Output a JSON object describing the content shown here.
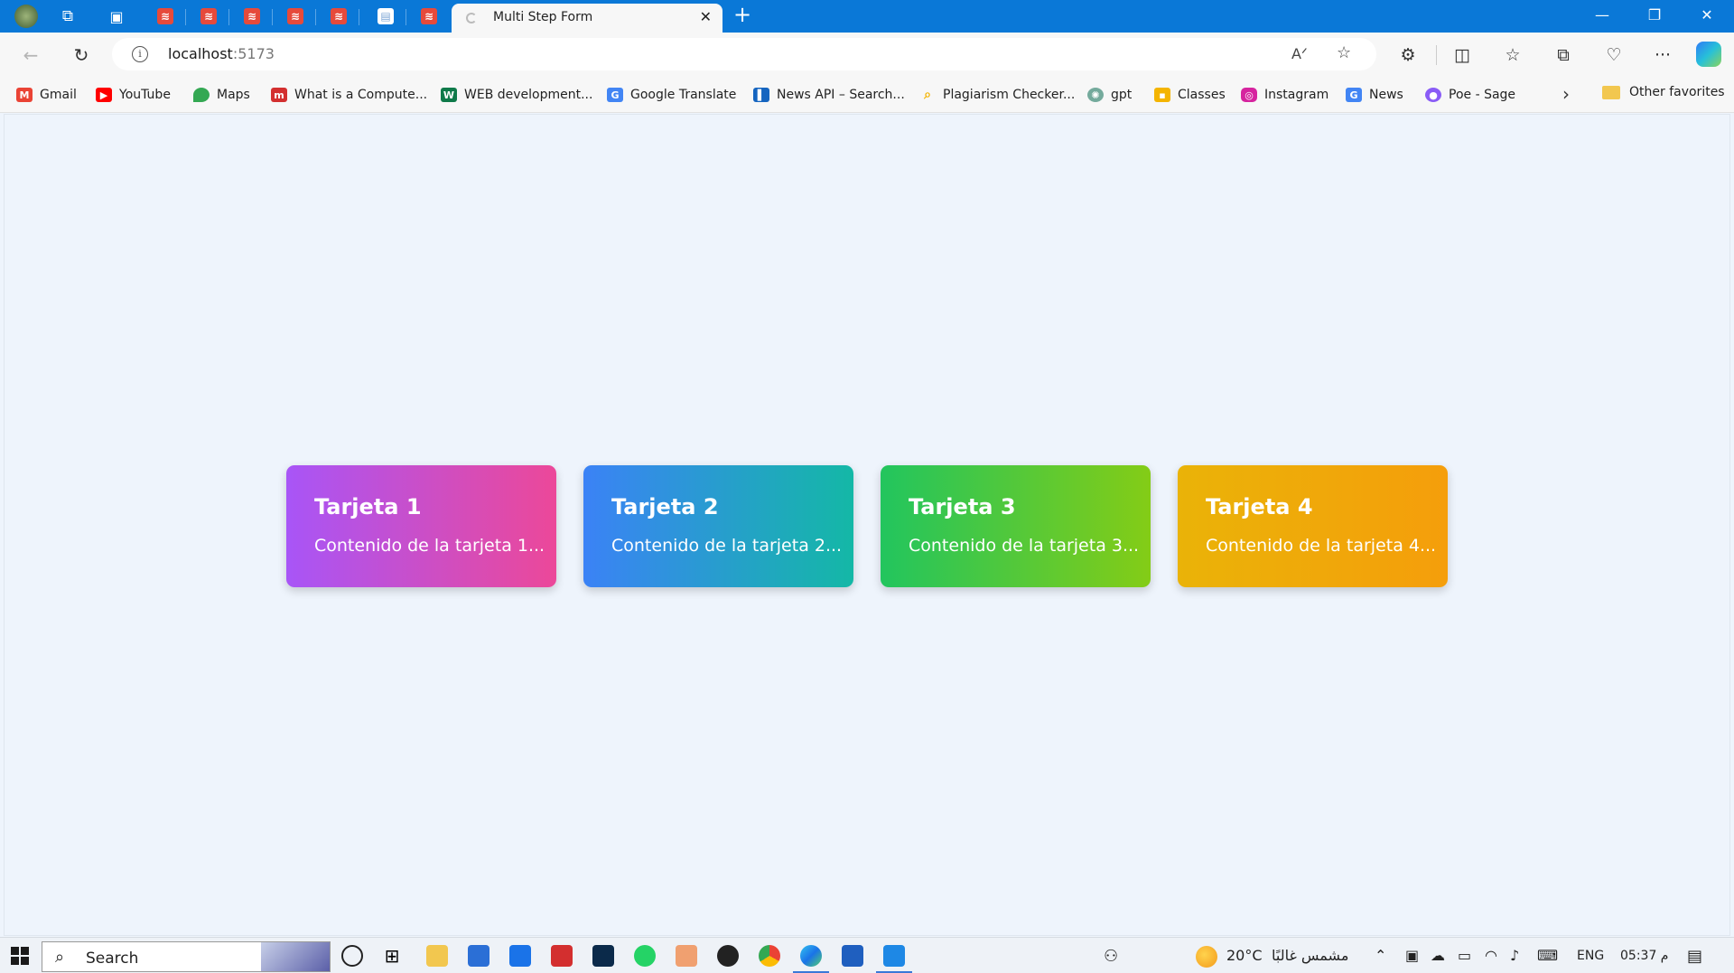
{
  "browser": {
    "active_tab_title": "Multi Step Form",
    "address": {
      "host": "localhost",
      "port": ":5173"
    },
    "favorites": [
      {
        "label": "Gmail",
        "icon": "gmail-icon",
        "color": "#ea4335"
      },
      {
        "label": "YouTube",
        "icon": "youtube-icon",
        "color": "#ff0000"
      },
      {
        "label": "Maps",
        "icon": "maps-icon",
        "color": "#34a853"
      },
      {
        "label": "What is a Compute...",
        "icon": "site-icon",
        "color": "#d32f2f"
      },
      {
        "label": "WEB development...",
        "icon": "site-icon",
        "color": "#0f7a4a"
      },
      {
        "label": "Google Translate",
        "icon": "translate-icon",
        "color": "#4285f4"
      },
      {
        "label": "News API – Search...",
        "icon": "news-api-icon",
        "color": "#1565c0"
      },
      {
        "label": "Plagiarism Checker...",
        "icon": "search-icon",
        "color": "#f4b400"
      },
      {
        "label": "gpt",
        "icon": "chatgpt-icon",
        "color": "#74aa9c"
      },
      {
        "label": "Classes",
        "icon": "classroom-icon",
        "color": "#f4b400"
      },
      {
        "label": "Instagram",
        "icon": "instagram-icon",
        "color": "#d6249f"
      },
      {
        "label": "News",
        "icon": "google-news-icon",
        "color": "#4285f4"
      },
      {
        "label": "Poe - Sage",
        "icon": "poe-icon",
        "color": "#8a5cf6"
      }
    ],
    "other_favorites": "Other favorites"
  },
  "cards": [
    {
      "title": "Tarjeta 1",
      "body": "Contenido de la tarjeta 1...",
      "colors": [
        "#a855f7",
        "#ec4899"
      ]
    },
    {
      "title": "Tarjeta 2",
      "body": "Contenido de la tarjeta 2...",
      "colors": [
        "#3b82f6",
        "#14b8a6"
      ]
    },
    {
      "title": "Tarjeta 3",
      "body": "Contenido de la tarjeta 3...",
      "colors": [
        "#22c55e",
        "#84cc16"
      ]
    },
    {
      "title": "Tarjeta 4",
      "body": "Contenido de la tarjeta 4...",
      "colors": [
        "#eab308",
        "#f59e0b"
      ]
    }
  ],
  "taskbar": {
    "search_label": "Search",
    "temperature": "20°C",
    "weather_text": "مشمس غالبًا",
    "language": "ENG",
    "time": "05:37 م"
  }
}
